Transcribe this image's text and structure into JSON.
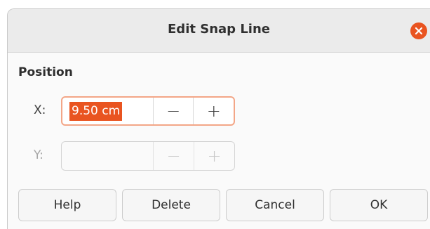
{
  "dialog": {
    "title": "Edit Snap Line",
    "close_icon": "close-icon"
  },
  "position": {
    "section_label": "Position",
    "x": {
      "label": "X:",
      "value": "9.50 cm",
      "decrement": "−",
      "increment": "+"
    },
    "y": {
      "label": "Y:",
      "value": "",
      "decrement": "−",
      "increment": "+"
    }
  },
  "buttons": {
    "help": "Help",
    "delete": "Delete",
    "cancel": "Cancel",
    "ok": "OK"
  },
  "colors": {
    "accent": "#e95420",
    "focus_border": "#f3a687"
  }
}
